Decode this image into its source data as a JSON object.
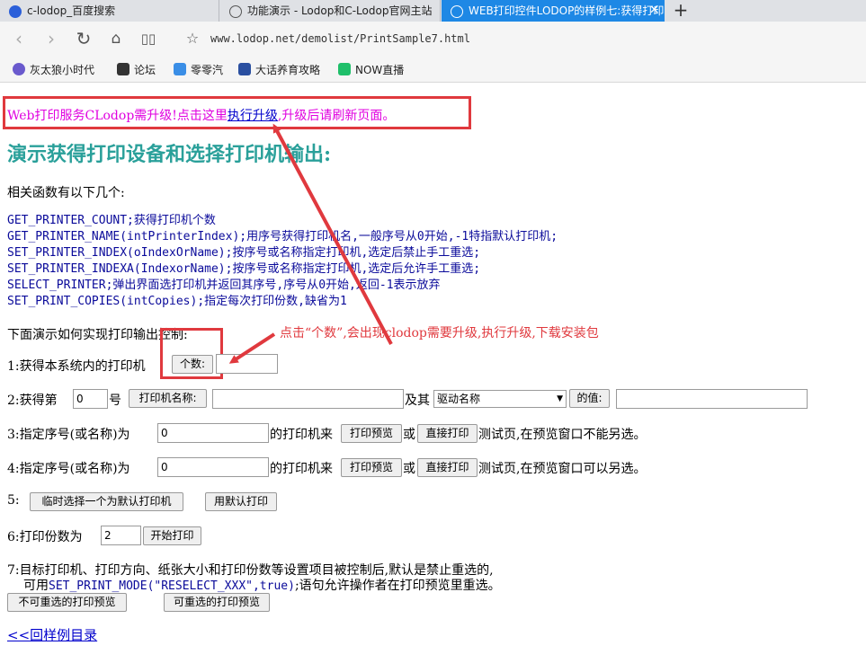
{
  "tabs": [
    {
      "label": "c-lodop_百度搜索"
    },
    {
      "label": "功能演示 - Lodop和C-Lodop官网主站"
    },
    {
      "label": "WEB打印控件LODOP的样例七:获得打印"
    }
  ],
  "url": "www.lodop.net/demolist/PrintSample7.html",
  "bookmarks": [
    "灰太狼小时代",
    "论坛",
    "零零汽",
    "大话养育攻略",
    "NOW直播"
  ],
  "upgrade": {
    "prefix": "Web打印服务CLodop需升级!点击这里",
    "link": "执行升级",
    "suffix": ",升级后请刷新页面。"
  },
  "title": "演示获得打印设备和选择打印机输出:",
  "intro": "相关函数有以下几个:",
  "functions": [
    "GET_PRINTER_COUNT;获得打印机个数",
    "GET_PRINTER_NAME(intPrinterIndex);用序号获得打印机名,一般序号从0开始,-1特指默认打印机;",
    "SET_PRINTER_INDEX(oIndexOrName);按序号或名称指定打印机,选定后禁止手工重选;",
    "SET_PRINTER_INDEXA(IndexorName);按序号或名称指定打印机,选定后允许手工重选;",
    "SELECT_PRINTER;弹出界面选打印机并返回其序号,序号从0开始,返回-1表示放弃",
    "SET_PRINT_COPIES(intCopies);指定每次打印份数,缺省为1"
  ],
  "demo_heading": "下面演示如何实现打印输出控制:",
  "annotation": "点击“个数”,会出现clodop需要升级,执行升级,下载安装包",
  "row1": {
    "label": "1:获得本系统内的打印机",
    "button": "个数:",
    "value": ""
  },
  "row2": {
    "label_a": "2:获得第",
    "index": "0",
    "label_b": "号",
    "name_button": "打印机名称:",
    "name_value": "",
    "label_c": "及其",
    "select_value": "驱动名称",
    "value_button": "的值:",
    "value_value": ""
  },
  "row3": {
    "label": "3:指定序号(或名称)为",
    "index": "0",
    "mid": "的打印机来",
    "preview": "打印预览",
    "or": "或",
    "print": "直接打印",
    "suffix": "测试页,在预览窗口不能另选。"
  },
  "row4": {
    "label": "4:指定序号(或名称)为",
    "index": "0",
    "mid": "的打印机来",
    "preview": "打印预览",
    "or": "或",
    "print": "直接打印",
    "suffix": "测试页,在预览窗口可以另选。"
  },
  "row5": {
    "label": "5:",
    "temp_button": "临时选择一个为默认打印机",
    "default_button": "用默认打印"
  },
  "row6": {
    "label": "6:打印份数为",
    "copies": "2",
    "button": "开始打印"
  },
  "row7": {
    "line1": "7:目标打印机、打印方向、纸张大小和打印份数等设置项目被控制后,默认是禁止重选的,",
    "line2_a": "可用",
    "line2_code": "SET_PRINT_MODE(\"RESELECT_XXX\",true)",
    "line2_b": ";语句允许操作者在打印预览里重选。",
    "btn_no": "不可重选的打印预览",
    "btn_yes": "可重选的打印预览"
  },
  "back_link": "<<回样例目录",
  "colors": {
    "accent_tab": "#1e88e5",
    "title": "#2aa09a",
    "upgrade_text": "#e000e0",
    "link": "#0000cc",
    "annotation": "#e0393e",
    "function_text": "#0a0a9a"
  }
}
